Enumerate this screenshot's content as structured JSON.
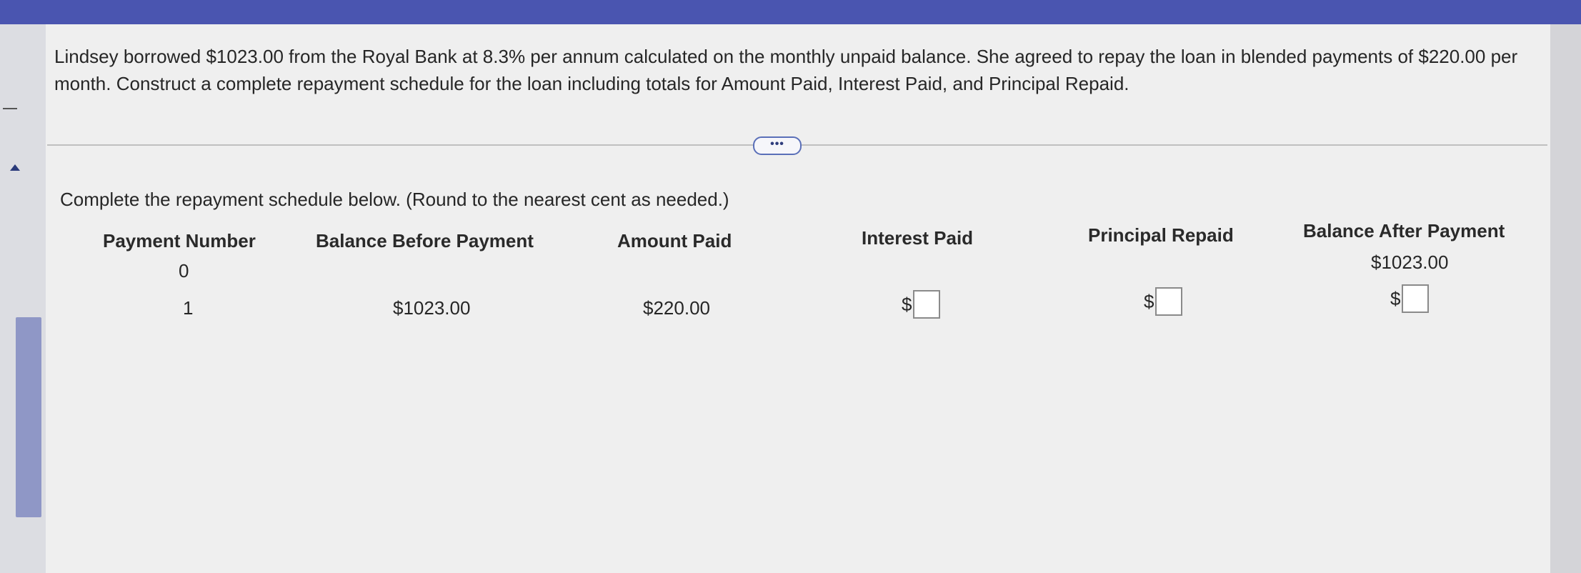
{
  "question": {
    "text": "Lindsey borrowed $1023.00 from the Royal Bank at 8.3% per annum calculated on the monthly unpaid balance. She agreed to repay the loan in blended payments of $220.00 per month. Construct a complete repayment schedule for the loan including totals for Amount Paid, Interest Paid, and Principal Repaid."
  },
  "more_button": {
    "label": "•••"
  },
  "instruction": "Complete the repayment schedule below. (Round to the nearest cent as needed.)",
  "table": {
    "headers": {
      "payment_number": "Payment Number",
      "balance_before": "Balance Before Payment",
      "amount_paid": "Amount Paid",
      "interest_paid": "Interest Paid",
      "principal_repaid": "Principal Repaid",
      "balance_after": "Balance After Payment"
    },
    "rows": [
      {
        "payment_number": "0",
        "balance_after": "$1023.00"
      },
      {
        "payment_number": "1",
        "balance_before": "$1023.00",
        "amount_paid": "$220.00",
        "interest_currency": "$",
        "principal_currency": "$",
        "balance_after_currency": "$"
      }
    ]
  },
  "colors": {
    "top_bar": "#4a55b0",
    "scroll_thumb": "#8f97c6",
    "content_bg": "#efefef"
  }
}
